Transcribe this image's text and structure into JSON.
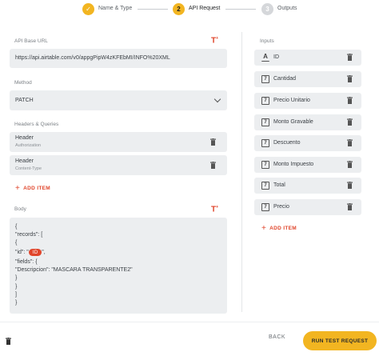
{
  "stepper": {
    "steps": [
      {
        "label": "Name & Type",
        "number": "1",
        "state": "done"
      },
      {
        "label": "API Request",
        "number": "2",
        "state": "active"
      },
      {
        "label": "Outputs",
        "number": "3",
        "state": "idle"
      }
    ]
  },
  "api": {
    "base_url_label": "API Base URL",
    "base_url_value": "https://api.airtable.com/v0/appgPipW4zKFEbMI/INFO%20XML"
  },
  "method": {
    "label": "Method",
    "value": "PATCH"
  },
  "headers": {
    "label": "Headers & Queries",
    "items": [
      {
        "title": "Header",
        "subtitle": "Authorization"
      },
      {
        "title": "Header",
        "subtitle": "Content-Type"
      }
    ],
    "add_label": "ADD ITEM"
  },
  "body": {
    "label": "Body",
    "lines": [
      "{",
      "\"records\": [",
      "{",
      "\"fields\": {",
      "\"Descripcion\": \"MASCARA TRANSPARENTE2\"",
      "}",
      "}",
      "]",
      "}"
    ],
    "id_prefix": "\"id\": \"",
    "id_chip": "ID",
    "id_suffix": "\","
  },
  "inputs": {
    "label": "Inputs",
    "items": [
      {
        "label": "ID",
        "icon": "text-icon"
      },
      {
        "label": "Cantidad",
        "icon": "number-icon"
      },
      {
        "label": "Precio Unitario",
        "icon": "number-icon"
      },
      {
        "label": "Monto Gravable",
        "icon": "number-icon"
      },
      {
        "label": "Descuento",
        "icon": "number-icon"
      },
      {
        "label": "Monto Impuesto",
        "icon": "number-icon"
      },
      {
        "label": "Total",
        "icon": "number-icon"
      },
      {
        "label": "Precio",
        "icon": "number-icon"
      }
    ],
    "add_label": "ADD ITEM"
  },
  "footer": {
    "back_label": "BACK",
    "run_label": "RUN TEST REQUEST"
  },
  "icons": {
    "number_glyph": "7",
    "text_glyph": "A",
    "check_glyph": "✓",
    "insert_glyph": "T"
  },
  "colors": {
    "accent": "#f2b521",
    "danger": "#e0452b",
    "field_bg": "#eceef0"
  }
}
